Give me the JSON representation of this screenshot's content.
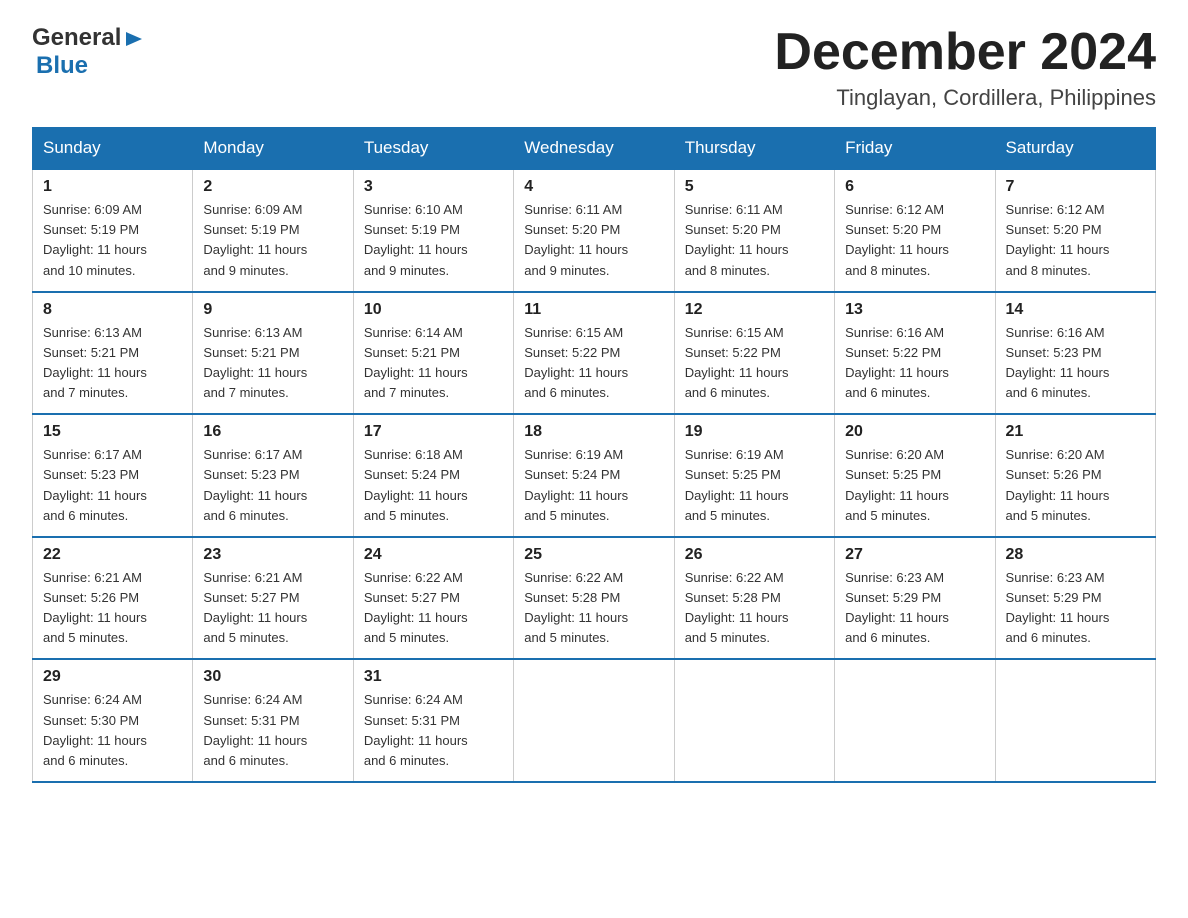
{
  "header": {
    "logo": {
      "general": "General",
      "blue": "Blue"
    },
    "title": "December 2024",
    "location": "Tinglayan, Cordillera, Philippines"
  },
  "weekdays": [
    "Sunday",
    "Monday",
    "Tuesday",
    "Wednesday",
    "Thursday",
    "Friday",
    "Saturday"
  ],
  "weeks": [
    [
      {
        "day": "1",
        "info": "Sunrise: 6:09 AM\nSunset: 5:19 PM\nDaylight: 11 hours\nand 10 minutes."
      },
      {
        "day": "2",
        "info": "Sunrise: 6:09 AM\nSunset: 5:19 PM\nDaylight: 11 hours\nand 9 minutes."
      },
      {
        "day": "3",
        "info": "Sunrise: 6:10 AM\nSunset: 5:19 PM\nDaylight: 11 hours\nand 9 minutes."
      },
      {
        "day": "4",
        "info": "Sunrise: 6:11 AM\nSunset: 5:20 PM\nDaylight: 11 hours\nand 9 minutes."
      },
      {
        "day": "5",
        "info": "Sunrise: 6:11 AM\nSunset: 5:20 PM\nDaylight: 11 hours\nand 8 minutes."
      },
      {
        "day": "6",
        "info": "Sunrise: 6:12 AM\nSunset: 5:20 PM\nDaylight: 11 hours\nand 8 minutes."
      },
      {
        "day": "7",
        "info": "Sunrise: 6:12 AM\nSunset: 5:20 PM\nDaylight: 11 hours\nand 8 minutes."
      }
    ],
    [
      {
        "day": "8",
        "info": "Sunrise: 6:13 AM\nSunset: 5:21 PM\nDaylight: 11 hours\nand 7 minutes."
      },
      {
        "day": "9",
        "info": "Sunrise: 6:13 AM\nSunset: 5:21 PM\nDaylight: 11 hours\nand 7 minutes."
      },
      {
        "day": "10",
        "info": "Sunrise: 6:14 AM\nSunset: 5:21 PM\nDaylight: 11 hours\nand 7 minutes."
      },
      {
        "day": "11",
        "info": "Sunrise: 6:15 AM\nSunset: 5:22 PM\nDaylight: 11 hours\nand 6 minutes."
      },
      {
        "day": "12",
        "info": "Sunrise: 6:15 AM\nSunset: 5:22 PM\nDaylight: 11 hours\nand 6 minutes."
      },
      {
        "day": "13",
        "info": "Sunrise: 6:16 AM\nSunset: 5:22 PM\nDaylight: 11 hours\nand 6 minutes."
      },
      {
        "day": "14",
        "info": "Sunrise: 6:16 AM\nSunset: 5:23 PM\nDaylight: 11 hours\nand 6 minutes."
      }
    ],
    [
      {
        "day": "15",
        "info": "Sunrise: 6:17 AM\nSunset: 5:23 PM\nDaylight: 11 hours\nand 6 minutes."
      },
      {
        "day": "16",
        "info": "Sunrise: 6:17 AM\nSunset: 5:23 PM\nDaylight: 11 hours\nand 6 minutes."
      },
      {
        "day": "17",
        "info": "Sunrise: 6:18 AM\nSunset: 5:24 PM\nDaylight: 11 hours\nand 5 minutes."
      },
      {
        "day": "18",
        "info": "Sunrise: 6:19 AM\nSunset: 5:24 PM\nDaylight: 11 hours\nand 5 minutes."
      },
      {
        "day": "19",
        "info": "Sunrise: 6:19 AM\nSunset: 5:25 PM\nDaylight: 11 hours\nand 5 minutes."
      },
      {
        "day": "20",
        "info": "Sunrise: 6:20 AM\nSunset: 5:25 PM\nDaylight: 11 hours\nand 5 minutes."
      },
      {
        "day": "21",
        "info": "Sunrise: 6:20 AM\nSunset: 5:26 PM\nDaylight: 11 hours\nand 5 minutes."
      }
    ],
    [
      {
        "day": "22",
        "info": "Sunrise: 6:21 AM\nSunset: 5:26 PM\nDaylight: 11 hours\nand 5 minutes."
      },
      {
        "day": "23",
        "info": "Sunrise: 6:21 AM\nSunset: 5:27 PM\nDaylight: 11 hours\nand 5 minutes."
      },
      {
        "day": "24",
        "info": "Sunrise: 6:22 AM\nSunset: 5:27 PM\nDaylight: 11 hours\nand 5 minutes."
      },
      {
        "day": "25",
        "info": "Sunrise: 6:22 AM\nSunset: 5:28 PM\nDaylight: 11 hours\nand 5 minutes."
      },
      {
        "day": "26",
        "info": "Sunrise: 6:22 AM\nSunset: 5:28 PM\nDaylight: 11 hours\nand 5 minutes."
      },
      {
        "day": "27",
        "info": "Sunrise: 6:23 AM\nSunset: 5:29 PM\nDaylight: 11 hours\nand 6 minutes."
      },
      {
        "day": "28",
        "info": "Sunrise: 6:23 AM\nSunset: 5:29 PM\nDaylight: 11 hours\nand 6 minutes."
      }
    ],
    [
      {
        "day": "29",
        "info": "Sunrise: 6:24 AM\nSunset: 5:30 PM\nDaylight: 11 hours\nand 6 minutes."
      },
      {
        "day": "30",
        "info": "Sunrise: 6:24 AM\nSunset: 5:31 PM\nDaylight: 11 hours\nand 6 minutes."
      },
      {
        "day": "31",
        "info": "Sunrise: 6:24 AM\nSunset: 5:31 PM\nDaylight: 11 hours\nand 6 minutes."
      },
      {
        "day": "",
        "info": ""
      },
      {
        "day": "",
        "info": ""
      },
      {
        "day": "",
        "info": ""
      },
      {
        "day": "",
        "info": ""
      }
    ]
  ]
}
